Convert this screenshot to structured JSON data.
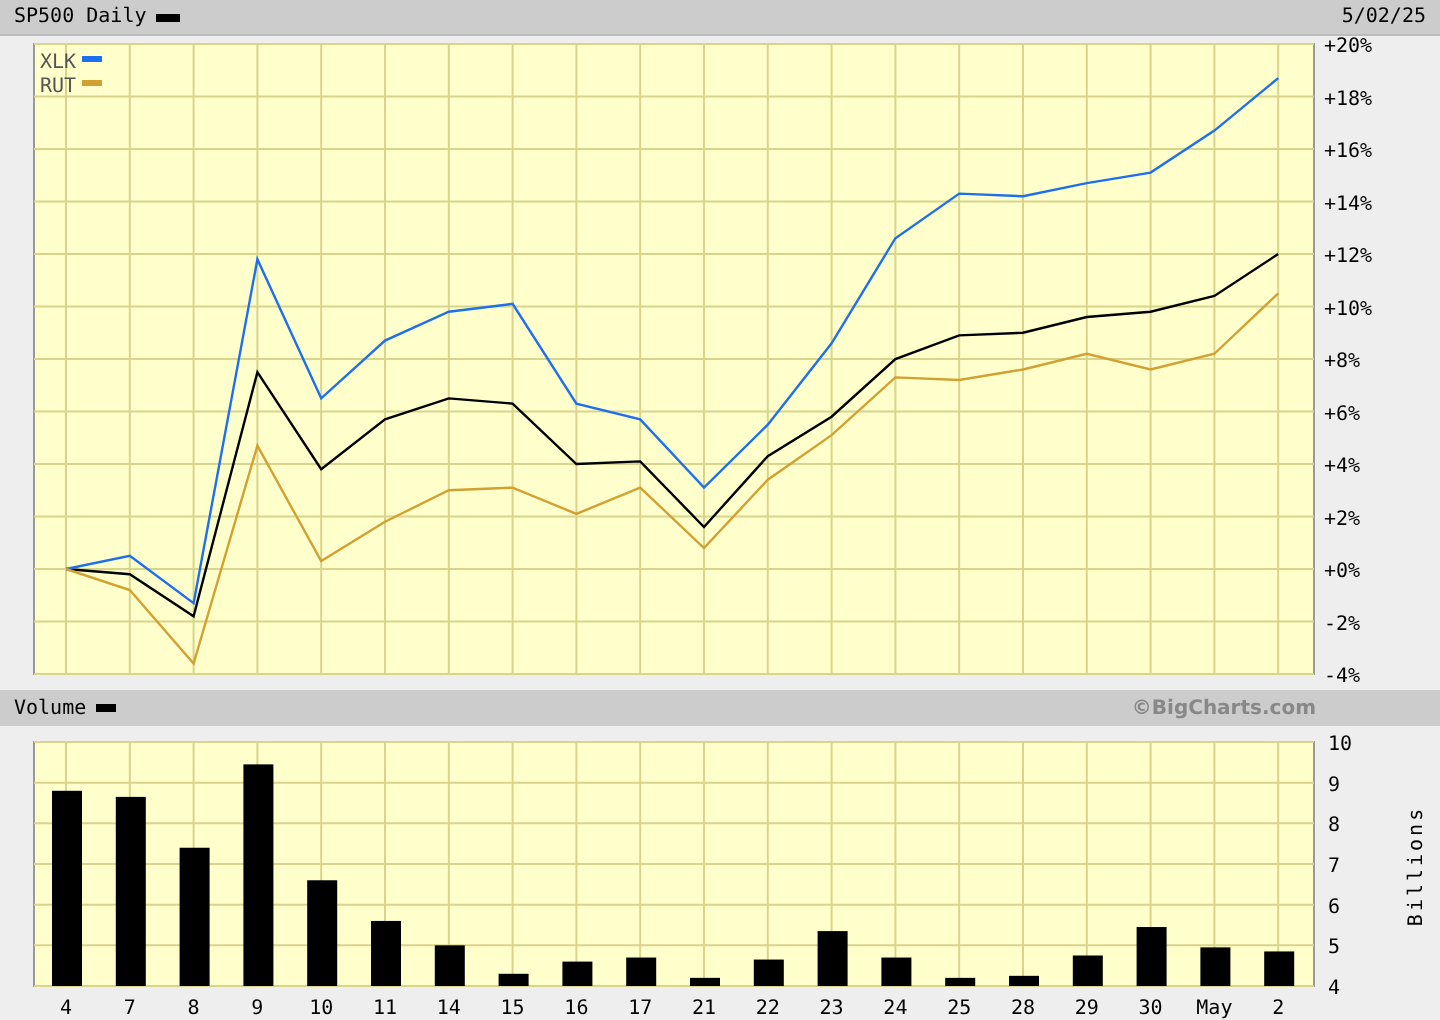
{
  "header": {
    "period": "Daily",
    "date": "5/02/25"
  },
  "price_chart": {
    "chart_data": {
      "type": "line",
      "grid": true,
      "legend": true,
      "ylim": [
        -4,
        20
      ],
      "yticks": [
        {
          "value": 20,
          "label": "+20%"
        },
        {
          "value": 18,
          "label": "+18%"
        },
        {
          "value": 16,
          "label": "+16%"
        },
        {
          "value": 14,
          "label": "+14%"
        },
        {
          "value": 12,
          "label": "+12%"
        },
        {
          "value": 10,
          "label": "+10%"
        },
        {
          "value": 8,
          "label": "+8%"
        },
        {
          "value": 6,
          "label": "+6%"
        },
        {
          "value": 4,
          "label": "+4%"
        },
        {
          "value": 2,
          "label": "+2%"
        },
        {
          "value": 0,
          "label": "+0%"
        },
        {
          "value": -2,
          "label": "-2%"
        },
        {
          "value": -4,
          "label": "-4%"
        }
      ],
      "series": [
        {
          "name": "SP500",
          "color": "#000000",
          "values": [
            0,
            -0.2,
            -1.8,
            7.5,
            3.8,
            5.7,
            6.5,
            6.3,
            4.0,
            4.1,
            1.6,
            4.3,
            5.8,
            8.0,
            8.9,
            9.0,
            9.6,
            9.8,
            10.4,
            12.0
          ]
        },
        {
          "name": "XLK",
          "color": "#1e6ff0",
          "values": [
            0,
            0.5,
            -1.3,
            11.8,
            6.5,
            8.7,
            9.8,
            10.1,
            6.3,
            5.7,
            3.1,
            5.5,
            8.6,
            12.6,
            14.3,
            14.2,
            14.7,
            15.1,
            16.7,
            18.7
          ]
        },
        {
          "name": "RUT",
          "color": "#d4a030",
          "values": [
            0,
            -0.8,
            -3.6,
            4.7,
            0.3,
            1.8,
            3.0,
            3.1,
            2.1,
            3.1,
            0.8,
            3.4,
            5.1,
            7.3,
            7.2,
            7.6,
            8.2,
            7.6,
            8.2,
            10.5
          ]
        }
      ]
    }
  },
  "volume_header": {
    "credit": "©BigCharts.com"
  },
  "volume_chart": {
    "chart_data": {
      "type": "bar",
      "grid": true,
      "ylabel": "Billions",
      "categories": [
        "4",
        "7",
        "8",
        "9",
        "10",
        "11",
        "14",
        "15",
        "16",
        "17",
        "21",
        "22",
        "23",
        "24",
        "25",
        "28",
        "29",
        "30",
        "May",
        "2"
      ],
      "ylim": [
        4,
        10
      ],
      "yticks": [
        4,
        5,
        6,
        7,
        8,
        9,
        10
      ],
      "series": [
        {
          "name": "Volume",
          "color": "#000000",
          "values": [
            8.8,
            8.65,
            7.4,
            9.45,
            6.6,
            5.6,
            5.0,
            4.3,
            4.6,
            4.7,
            4.2,
            4.65,
            5.35,
            4.7,
            4.2,
            4.25,
            4.75,
            5.45,
            4.95,
            4.85
          ]
        }
      ]
    }
  }
}
